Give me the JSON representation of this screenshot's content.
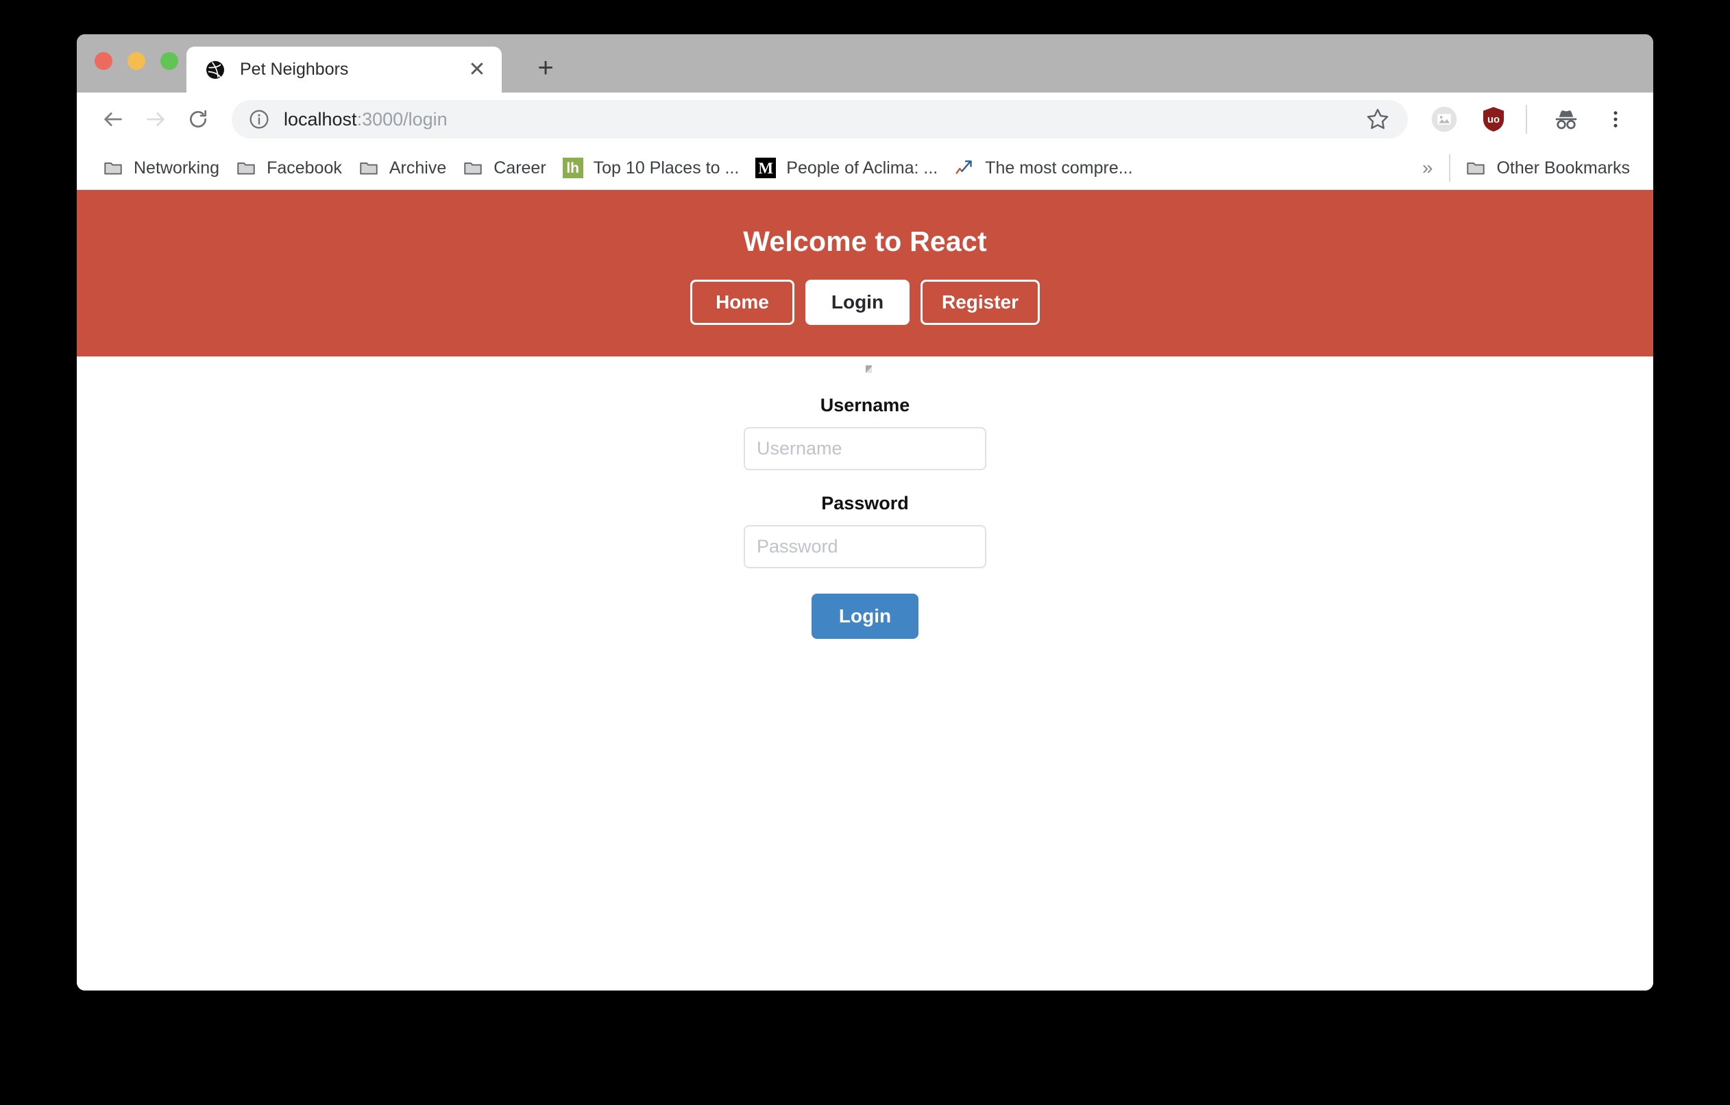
{
  "window": {
    "traffic_lights": [
      {
        "name": "close",
        "color": "#ee6a5f"
      },
      {
        "name": "minimize",
        "color": "#f5bd4f"
      },
      {
        "name": "zoom",
        "color": "#61c454"
      }
    ]
  },
  "tab": {
    "title": "Pet Neighbors",
    "favicon": "dribbble-ball-icon",
    "close_label": "✕",
    "new_tab_label": "+"
  },
  "toolbar": {
    "back_icon": "back-arrow-icon",
    "forward_icon": "forward-arrow-icon",
    "reload_icon": "reload-icon",
    "info_icon": "site-info-icon",
    "url_host": "localhost",
    "url_path": ":3000/login",
    "star_icon": "bookmark-star-icon",
    "extension_icon": "image-extension-icon",
    "ublock_icon": "ublock-origin-icon",
    "ublock_label": "uo",
    "ublock_color": "#8c1c1c",
    "incognito_icon": "incognito-icon",
    "menu_icon": "three-dot-menu-icon"
  },
  "bookmarks": {
    "items": [
      {
        "label": "Networking",
        "icon": "folder-icon"
      },
      {
        "label": "Facebook",
        "icon": "folder-icon"
      },
      {
        "label": "Archive",
        "icon": "folder-icon"
      },
      {
        "label": "Career",
        "icon": "folder-icon"
      },
      {
        "label": "Top 10 Places to ...",
        "icon": "lifehacker-icon"
      },
      {
        "label": "People of Aclima: ...",
        "icon": "medium-icon"
      },
      {
        "label": "The most compre...",
        "icon": "chart-arrow-icon"
      }
    ],
    "overflow_label": "»",
    "other": {
      "label": "Other Bookmarks",
      "icon": "folder-icon"
    }
  },
  "page": {
    "banner": {
      "title": "Welcome to React",
      "background": "#c8503f",
      "nav": [
        {
          "label": "Home",
          "active": false
        },
        {
          "label": "Login",
          "active": true
        },
        {
          "label": "Register",
          "active": false
        }
      ]
    },
    "form": {
      "username_label": "Username",
      "username_value": "",
      "username_placeholder": "Username",
      "password_label": "Password",
      "password_value": "",
      "password_placeholder": "Password",
      "submit_label": "Login",
      "submit_color": "#4285c4"
    }
  }
}
